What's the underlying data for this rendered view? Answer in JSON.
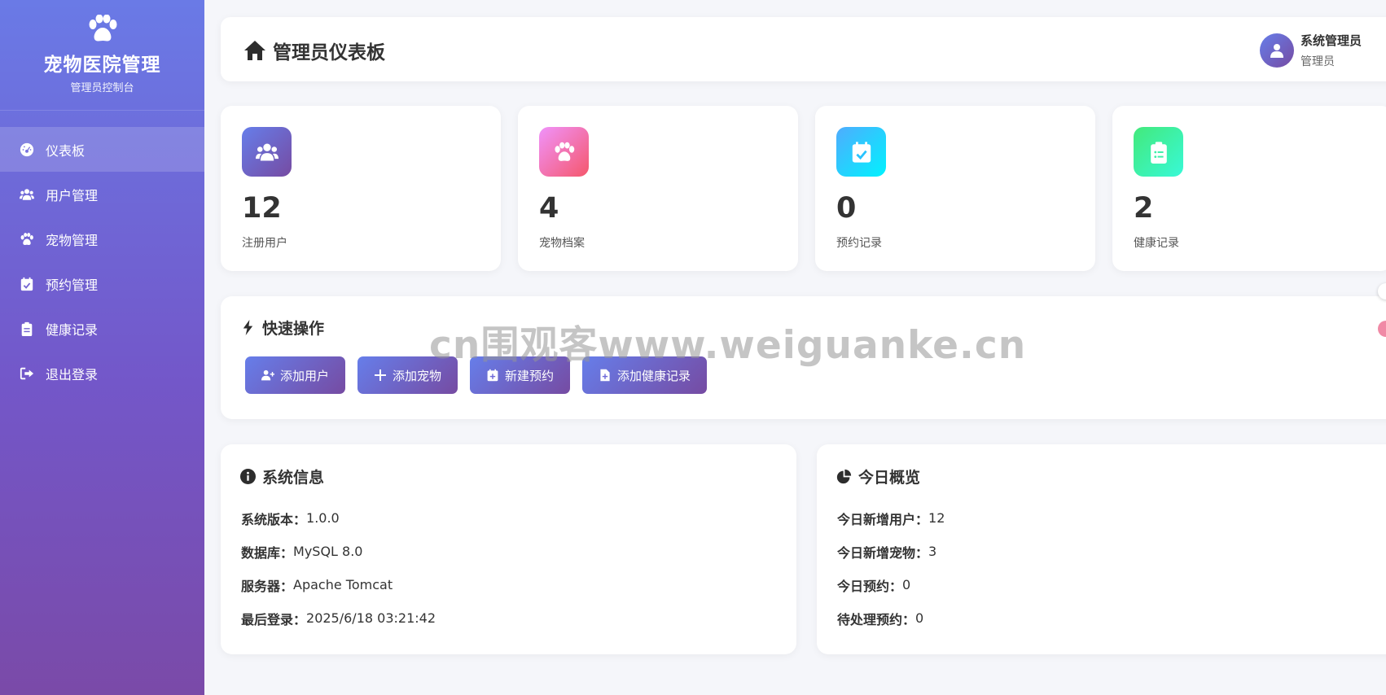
{
  "brand": {
    "title": "宠物医院管理",
    "subtitle": "管理员控制台"
  },
  "sidebar": {
    "items": [
      {
        "label": "仪表板",
        "icon": "dashboard-icon",
        "active": true
      },
      {
        "label": "用户管理",
        "icon": "users-icon"
      },
      {
        "label": "宠物管理",
        "icon": "paw-icon"
      },
      {
        "label": "预约管理",
        "icon": "calendar-check-icon"
      },
      {
        "label": "健康记录",
        "icon": "clipboard-icon"
      },
      {
        "label": "退出登录",
        "icon": "logout-icon"
      }
    ]
  },
  "header": {
    "title": "管理员仪表板",
    "user_name": "系统管理员",
    "user_role": "管理员"
  },
  "stats": [
    {
      "value": "12",
      "label": "注册用户",
      "icon": "users-icon",
      "color_from": "#667eea",
      "color_to": "#764ba2"
    },
    {
      "value": "4",
      "label": "宠物档案",
      "icon": "paw-icon",
      "color_from": "#f093fb",
      "color_to": "#f5576c"
    },
    {
      "value": "0",
      "label": "预约记录",
      "icon": "calendar-check-icon",
      "color_from": "#4facfe",
      "color_to": "#00f2fe"
    },
    {
      "value": "2",
      "label": "健康记录",
      "icon": "clipboard-list-icon",
      "color_from": "#43e97b",
      "color_to": "#38f9d7"
    }
  ],
  "quick_actions": {
    "title": "快速操作",
    "buttons": [
      {
        "label": "添加用户",
        "icon": "user-plus-icon"
      },
      {
        "label": "添加宠物",
        "icon": "plus-icon"
      },
      {
        "label": "新建预约",
        "icon": "calendar-plus-icon"
      },
      {
        "label": "添加健康记录",
        "icon": "file-medical-icon"
      }
    ]
  },
  "system_info": {
    "title": "系统信息",
    "rows": [
      {
        "key": "系统版本：",
        "value": "1.0.0"
      },
      {
        "key": "数据库：",
        "value": "MySQL 8.0"
      },
      {
        "key": "服务器：",
        "value": "Apache Tomcat"
      },
      {
        "key": "最后登录：",
        "value": "2025/6/18 03:21:42"
      }
    ]
  },
  "today_overview": {
    "title": "今日概览",
    "rows": [
      {
        "key": "今日新增用户：",
        "value": "12"
      },
      {
        "key": "今日新增宠物：",
        "value": "3"
      },
      {
        "key": "今日预约：",
        "value": "0"
      },
      {
        "key": "待处理预约：",
        "value": "0"
      }
    ]
  },
  "watermark": "cn围观客www.weiguanke.cn"
}
